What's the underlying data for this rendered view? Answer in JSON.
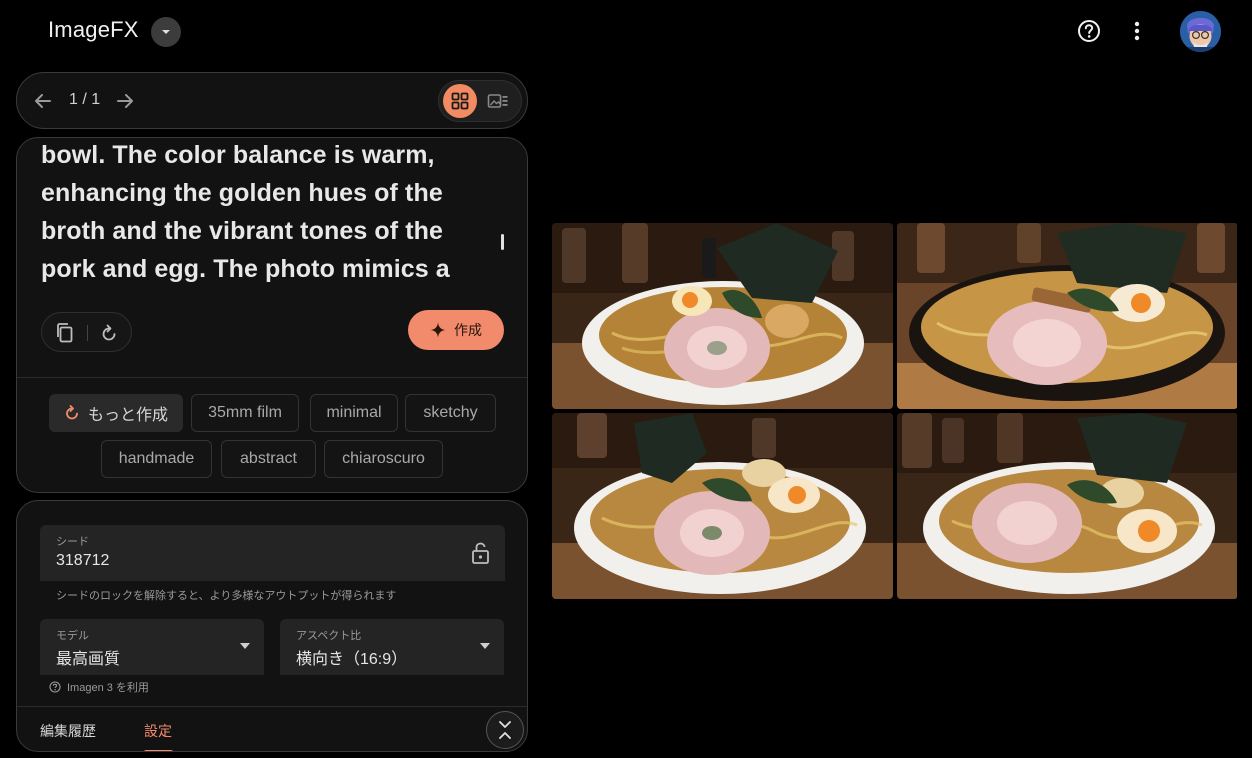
{
  "app": {
    "title": "ImageFX",
    "brand_dropdown_icon": "chevron-down-icon",
    "help_icon": "help-circle-icon",
    "more_icon": "more-vert-icon"
  },
  "nav": {
    "counter": "1 / 1",
    "view_mode": "grid"
  },
  "prompt": {
    "lines": [
      "bowl. The color balance is warm,",
      "enhancing the golden hues of the",
      "broth and the vibrant tones of the",
      "pork and egg. The photo mimics a"
    ],
    "create_label": "作成"
  },
  "chips": {
    "more": "もっと作成",
    "items": [
      "35mm film",
      "minimal",
      "sketchy",
      "handmade",
      "abstract",
      "chiaroscuro"
    ]
  },
  "settings": {
    "seed_label": "シード",
    "seed_value": "318712",
    "seed_help": "シードのロックを解除すると、より多様なアウトプットが得られます",
    "model_label": "モデル",
    "model_value": "最高画質",
    "aspect_label": "アスペクト比",
    "aspect_value": "横向き（16:9）",
    "imagen_note": "Imagen 3 を利用"
  },
  "tabs": {
    "history": "編集履歴",
    "settings": "設定",
    "active": "settings"
  },
  "colors": {
    "accent": "#f28b6b",
    "background": "#000000",
    "card": "#121212"
  }
}
